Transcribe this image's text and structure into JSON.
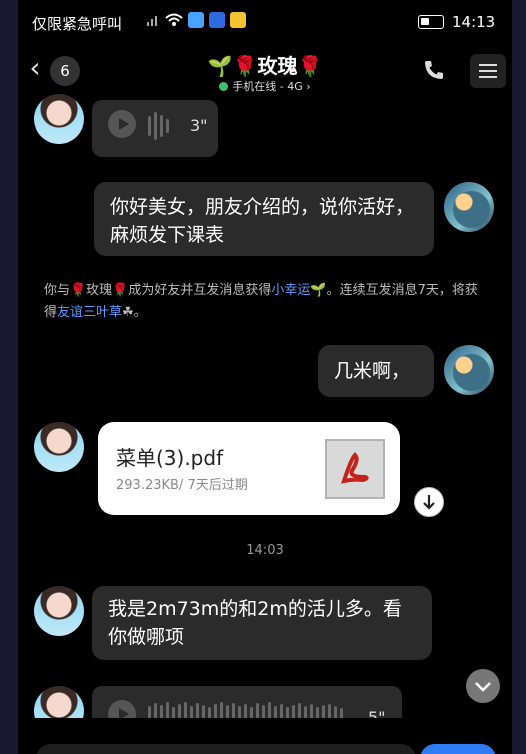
{
  "status_bar": {
    "carrier": "仅限紧急呼叫",
    "time": "14:13"
  },
  "header": {
    "back_icon": "chevron-left-icon",
    "unread_count": "6",
    "title": "🌱🌹玫瑰🌹",
    "online_status": "手机在线 - 4G ›",
    "call_icon": "phone-icon",
    "menu_icon": "hamburger-menu-icon"
  },
  "messages": {
    "voice_1": {
      "duration": "3\""
    },
    "sent_1": {
      "text": "你好美女，朋友介绍的，说你活好，麻烦发下课表"
    },
    "system": {
      "part1": "你与🌹玫瑰🌹成为好友并互发消息获得",
      "link1": "小幸运",
      "part2": "🌱。连续互发消息7天，将获得",
      "link2": "友谊三叶草",
      "part3": "☘。"
    },
    "sent_2": {
      "text": "几米啊，"
    },
    "file": {
      "name": "菜单(3).pdf",
      "info": "293.23KB/ 7天后过期",
      "icon": "pdf-icon",
      "download_icon": "download-icon"
    },
    "timestamp": "14:03",
    "received_1": {
      "text": "我是2m73m的和2m的活儿多。看你做哪项"
    },
    "voice_2": {
      "duration": "5\""
    }
  },
  "scroll_down_icon": "chevron-down-icon",
  "colors": {
    "background": "#000000",
    "bubble": "#2b2b2b",
    "link": "#5b9bff",
    "online": "#3ec16a"
  }
}
